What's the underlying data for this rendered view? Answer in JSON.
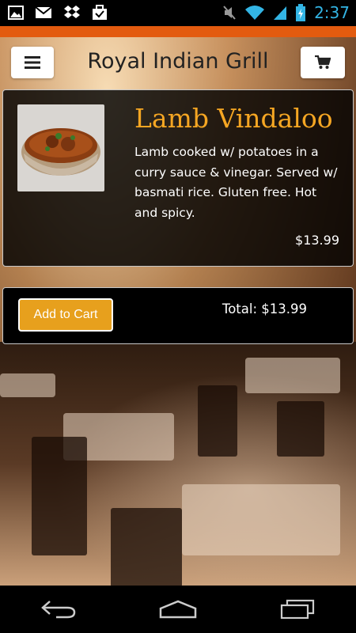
{
  "status_bar": {
    "time": "2:37",
    "left_icons": [
      "image-icon",
      "gmail-icon",
      "dropbox-icon",
      "briefcase-check-icon"
    ],
    "right_icons": [
      "mute-icon",
      "wifi-icon",
      "signal-icon",
      "battery-charging-icon"
    ]
  },
  "header": {
    "title": "Royal Indian Grill",
    "menu_icon": "hamburger-icon",
    "cart_icon": "shopping-cart-icon"
  },
  "item": {
    "name": "Lamb Vindaloo",
    "description": "Lamb cooked w/ potatoes in a curry sauce & vinegar. Served w/ basmati rice. Gluten free. Hot and spicy.",
    "price": "$13.99"
  },
  "cart": {
    "add_label": "Add to Cart",
    "total": "Total: $13.99"
  },
  "navbar": {
    "icons": [
      "back-icon",
      "home-icon",
      "recent-apps-icon"
    ]
  },
  "colors": {
    "accent_orange": "#e35b0f",
    "title_gold": "#f5a623",
    "button_gold": "#e7a01d",
    "clock_blue": "#33b5e5"
  }
}
